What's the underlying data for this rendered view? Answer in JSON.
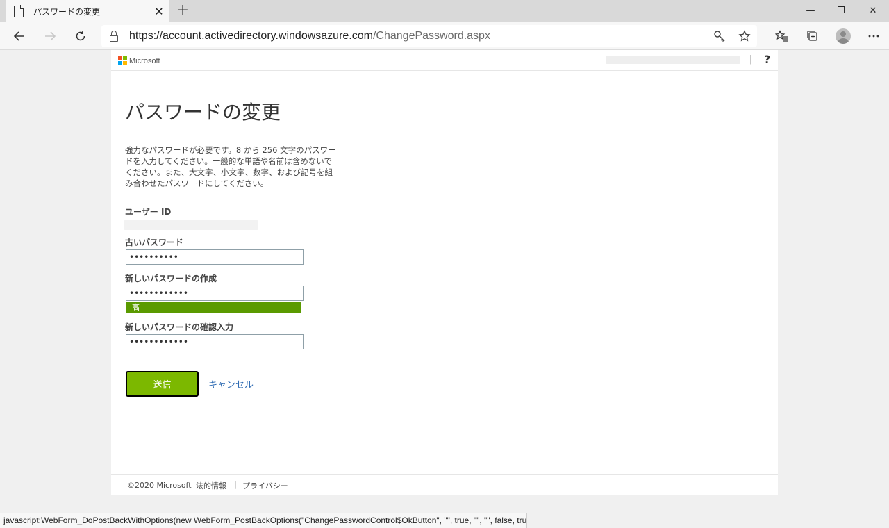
{
  "browser": {
    "tab_title": "パスワードの変更",
    "tab_close": "✕",
    "new_tab": "+",
    "minimize": "—",
    "restore": "❐",
    "close": "✕",
    "url_host": "https://account.activedirectory.windowsazure.com",
    "url_path": "/ChangePassword.aspx",
    "icons": [
      "page-icon",
      "back-icon",
      "forward-icon",
      "refresh-icon",
      "lock-icon",
      "key-icon",
      "star-icon",
      "favorites-icon",
      "collections-icon",
      "profile-avatar",
      "more-icon"
    ]
  },
  "header": {
    "brand": "Microsoft",
    "separator": "|",
    "help": "?"
  },
  "page": {
    "title": "パスワードの変更",
    "intro_lines": [
      "強力なパスワードが必要です。8 から 256 文字のパスワー",
      "ドを入力してください。一般的な単語や名前は含めないで",
      "ください。また、大文字、小文字、数字、および記号を組",
      "み合わせたパスワードにしてください。"
    ],
    "user_id_label": "ユーザー ID",
    "old_password_label": "古いパスワード",
    "old_password_value": "••••••••••",
    "new_password_label": "新しいパスワードの作成",
    "new_password_value": "••••••••••••",
    "strength_label": "高",
    "confirm_password_label": "新しいパスワードの確認入力",
    "confirm_password_value": "••••••••••••",
    "submit_label": "送信",
    "cancel_label": "キャンセル"
  },
  "footer": {
    "copyright": "©2020 Microsoft",
    "legal": "法的情報",
    "separator": "|",
    "privacy": "プライバシー"
  },
  "status_bar": "javascript:WebForm_DoPostBackWithOptions(new WebForm_PostBackOptions(\"ChangePasswordControl$OkButton\", \"\", true, \"\", \"\", false, true))",
  "colors": {
    "submit_bg": "#7cb800",
    "strength_bg": "#5a9a00",
    "link": "#2e6bb3"
  }
}
